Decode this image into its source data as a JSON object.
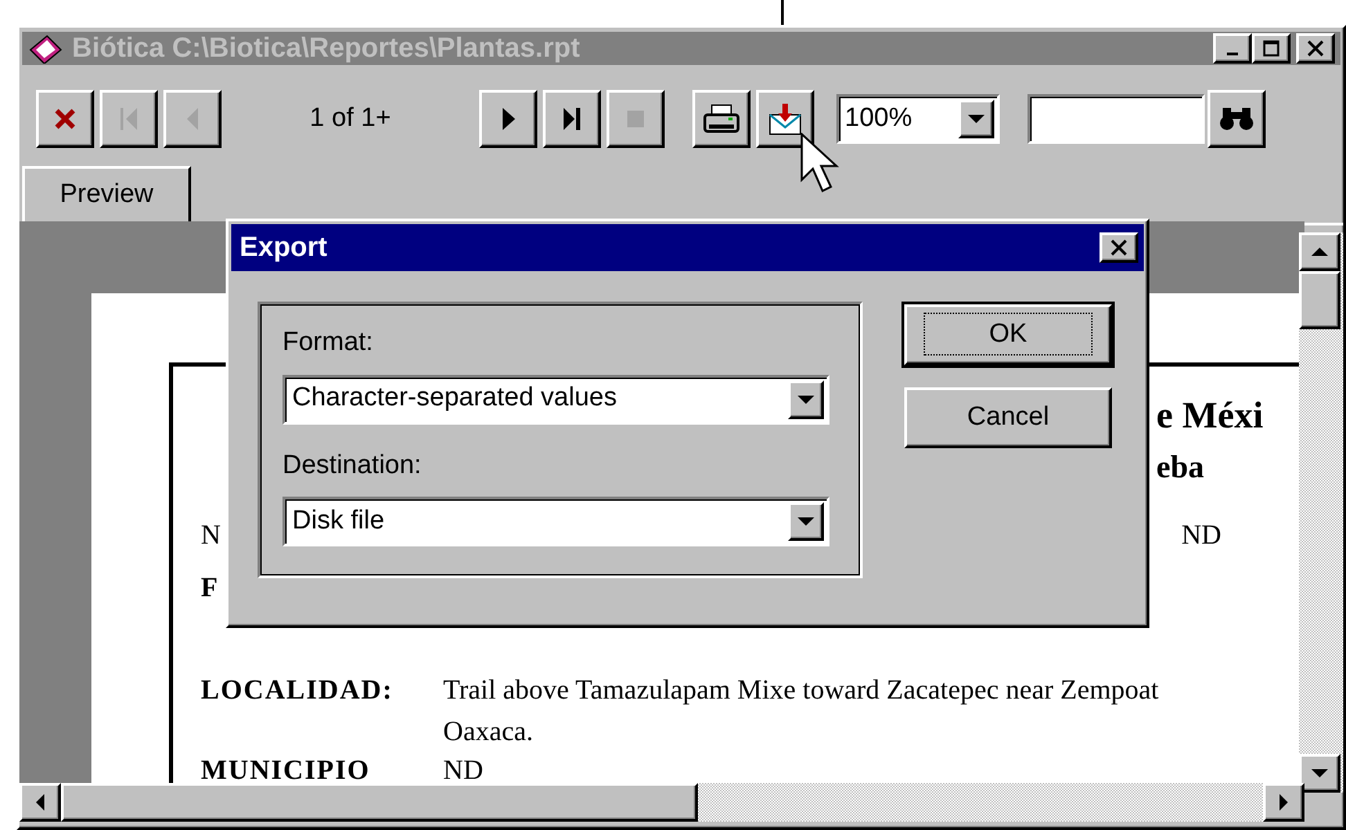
{
  "window": {
    "title": "Biótica C:\\Biotica\\Reportes\\Plantas.rpt"
  },
  "toolbar": {
    "nav_left": [
      {
        "kind": "cancel",
        "disabled": false
      },
      {
        "kind": "first",
        "disabled": true
      },
      {
        "kind": "previous",
        "disabled": true
      }
    ],
    "page_indicator": "1 of 1+",
    "nav_right": [
      {
        "kind": "next",
        "disabled": false
      },
      {
        "kind": "last",
        "disabled": false
      },
      {
        "kind": "stop",
        "disabled": true
      }
    ],
    "output": [
      {
        "kind": "print",
        "disabled": false
      },
      {
        "kind": "export",
        "disabled": false
      }
    ],
    "zoom": "100%"
  },
  "tabs": [
    {
      "label": "Preview",
      "selected": true
    }
  ],
  "report": {
    "title": "e Méxi",
    "subtitle": "eba",
    "fields": [
      {
        "kind": "split",
        "label": "N",
        "value": "ND"
      },
      {
        "kind": "label",
        "label": "F"
      },
      {
        "kind": "pair",
        "label": "LOCALIDAD:",
        "value": "Trail above Tamazulapam Mixe toward Zacatepec near Zempoat",
        "continuation": "Oaxaca."
      },
      {
        "kind": "pair",
        "label": "MUNICIPIO",
        "value": "ND"
      }
    ]
  },
  "dialog": {
    "title": "Export",
    "format_label": "Format:",
    "format_value": "Character-separated values",
    "destination_label": "Destination:",
    "destination_value": "Disk file",
    "buttons": [
      {
        "label": "OK",
        "default": true
      },
      {
        "label": "Cancel",
        "default": false
      }
    ]
  }
}
